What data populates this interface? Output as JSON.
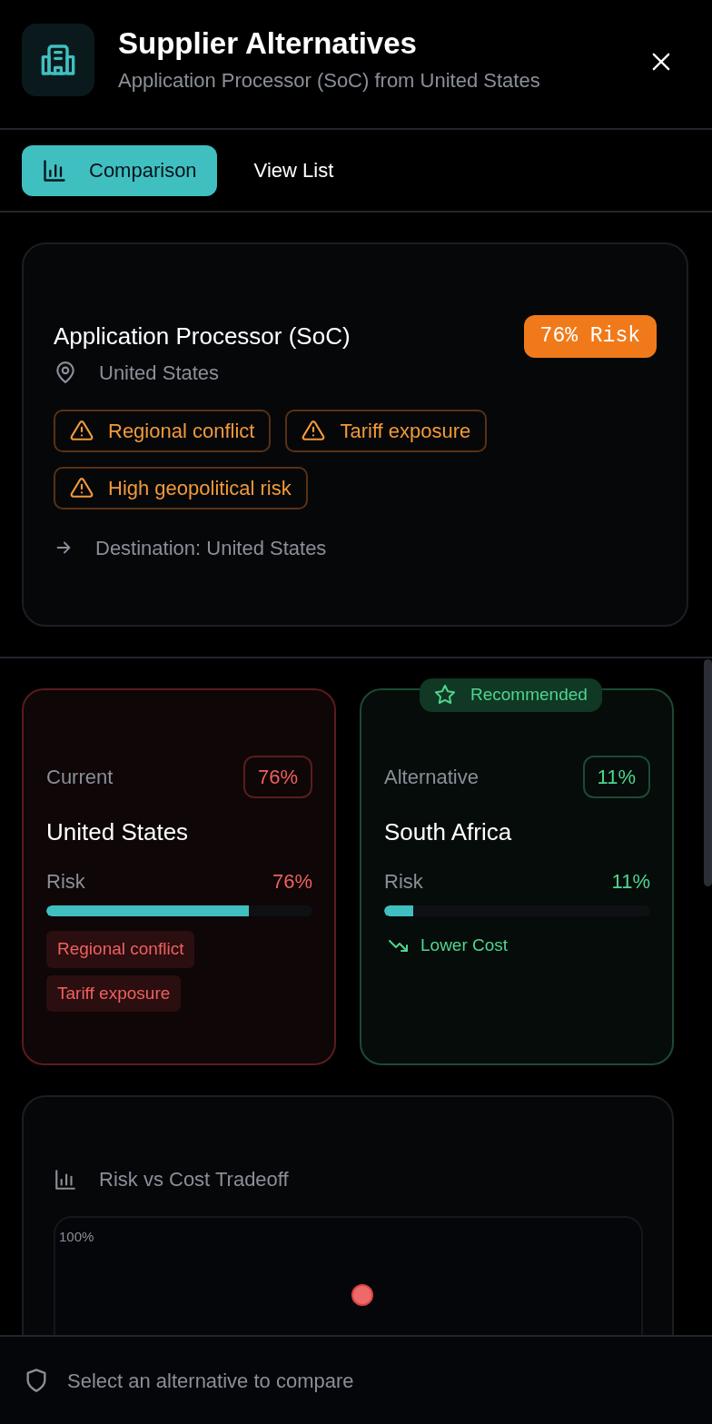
{
  "header": {
    "title": "Supplier Alternatives",
    "subtitle": "Application Processor (SoC) from United States"
  },
  "tabs": [
    {
      "label": "Comparison",
      "selected": true
    },
    {
      "label": "View List",
      "selected": false
    }
  ],
  "component": {
    "name": "Application Processor (SoC)",
    "risk_badge": "76% Risk",
    "location": "United States",
    "warnings": [
      "Regional conflict",
      "Tariff exposure",
      "High geopolitical risk"
    ],
    "destination": "Destination: United States"
  },
  "options": [
    {
      "kind": "current",
      "recommended": false,
      "role": "Current",
      "badge": "76%",
      "country": "United States",
      "risk_label": "Risk",
      "risk_value": "76%",
      "level": 0.76,
      "tags": [
        "Regional conflict",
        "Tariff exposure"
      ]
    },
    {
      "kind": "alternative",
      "recommended": true,
      "recommended_label": "Recommended",
      "role": "Alternative",
      "badge": "11%",
      "country": "South Africa",
      "risk_label": "Risk",
      "risk_value": "11%",
      "level": 0.11,
      "note": "Lower Cost"
    }
  ],
  "tradeoff": {
    "title": "Risk vs Cost Tradeoff",
    "y_top_label": "100%"
  },
  "footer": {
    "text": "Select an alternative to compare"
  }
}
